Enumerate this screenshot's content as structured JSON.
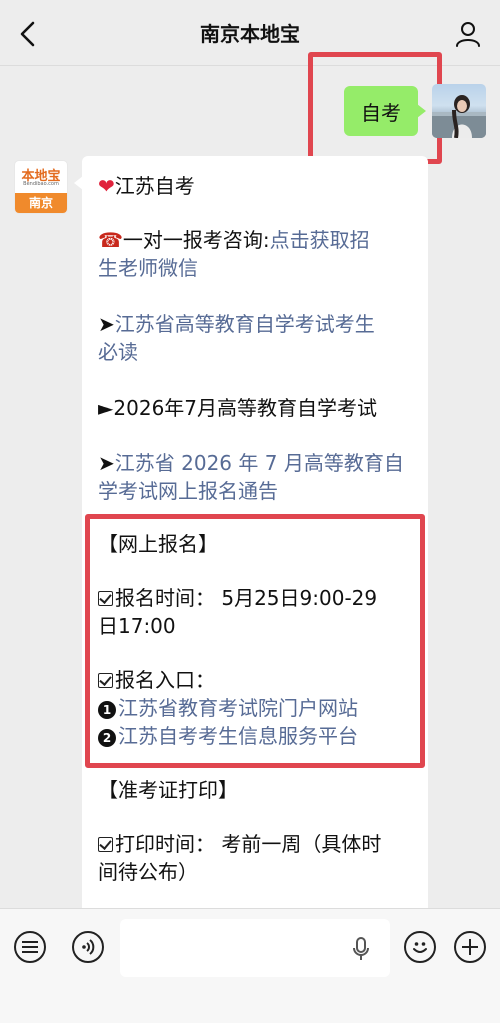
{
  "header": {
    "title": "南京本地宝",
    "back_icon": "chevron-left-icon",
    "profile_icon": "person-icon"
  },
  "user_message": {
    "text": "自考",
    "bubble_color": "#95ec69"
  },
  "bot_avatar": {
    "logo_text": "本地宝",
    "logo_sub": "Bendibao.com",
    "city": "南京",
    "brand_color": "#f08a2c"
  },
  "bot_message": {
    "title": "江苏自考",
    "consult_prefix": "一对一报考咨询:",
    "consult_link_1": "点击获取招",
    "consult_link_2": "生老师微信",
    "guide_arrow": "➤",
    "guide_link_1": "江苏省高等教育自学考试考生",
    "guide_link_2": "必读",
    "exam_arrow": "►",
    "exam_title": "2026年7月高等教育自学考试",
    "notice_arrow": "➤",
    "notice_link_1": "江苏省 2026 年 7 月高等教育自",
    "notice_link_2": "学考试网上报名通告",
    "online_reg_heading": "【网上报名】",
    "reg_time_line_1": "报名时间：  5月25日9:00-29",
    "reg_time_line_2": "日17:00",
    "reg_entry_label": "报名入口：",
    "entry_1_num": "1",
    "entry_1_link": "江苏省教育考试院门户网站",
    "entry_2_num": "2",
    "entry_2_link": "江苏自考考生信息服务平台",
    "admission_heading": "【准考证打印】",
    "print_time_line_1": "打印时间：  考前一周（具体时",
    "print_time_line_2": "间待公布）"
  },
  "colors": {
    "highlight_border": "#e0464f",
    "link": "#576b95",
    "background": "#ededed"
  },
  "bottom_bar": {
    "menu_icon": "menu-list-icon",
    "voice_icon": "voice-icon",
    "mic_icon": "microphone-icon",
    "emoji_icon": "emoji-icon",
    "add_icon": "plus-icon"
  }
}
